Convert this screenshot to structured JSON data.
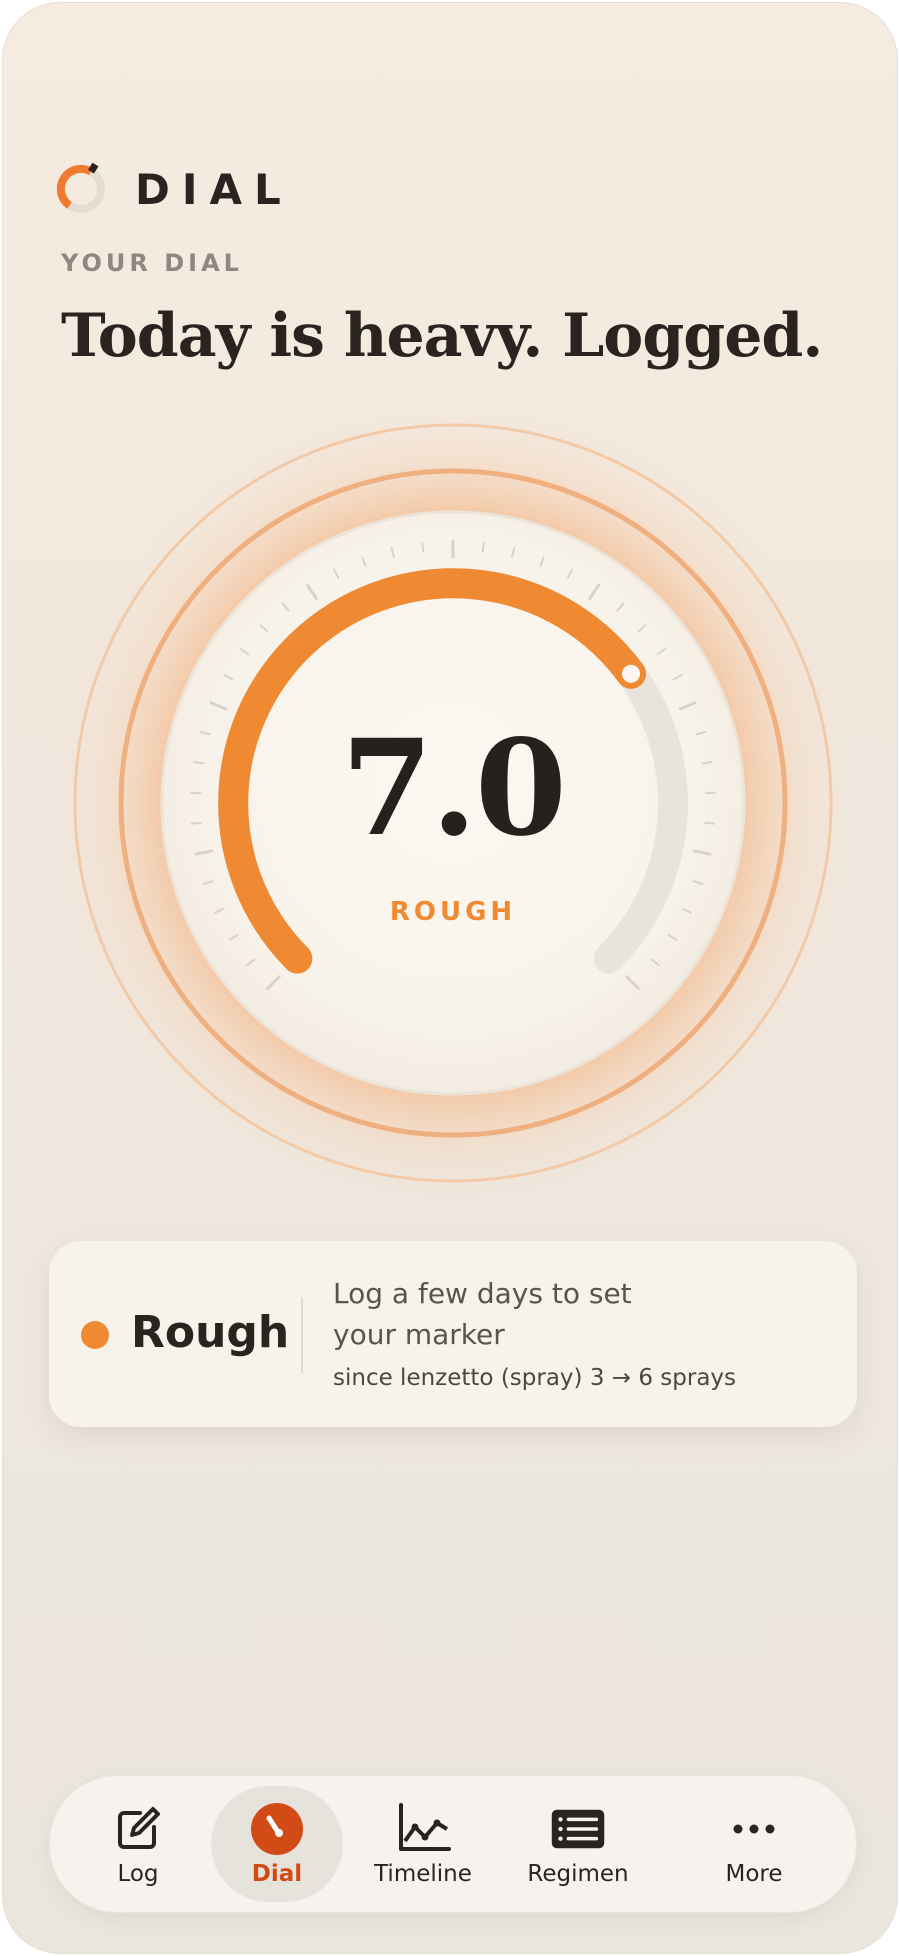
{
  "app": {
    "name": "DIAL",
    "accent_color": "#f08a32"
  },
  "header": {
    "eyebrow": "YOUR DIAL",
    "headline": "Today is heavy. Logged."
  },
  "dial": {
    "value": "7.0",
    "state_label": "ROUGH",
    "fill_fraction": 0.7,
    "fill_color": "#f08a32",
    "track_color": "#e8e4dd"
  },
  "status_card": {
    "state": "Rough",
    "dot_color": "#f08a32",
    "message": "Log a few days to set your marker",
    "detail": "since lenzetto (spray) 3 → 6 sprays"
  },
  "nav": {
    "items": [
      {
        "label": "Log",
        "icon": "edit-icon",
        "active": false
      },
      {
        "label": "Dial",
        "icon": "dial-icon",
        "active": true
      },
      {
        "label": "Timeline",
        "icon": "line-chart-icon",
        "active": false
      },
      {
        "label": "Regimen",
        "icon": "list-icon",
        "active": false
      },
      {
        "label": "More",
        "icon": "more-dots-icon",
        "active": false
      }
    ],
    "active_color": "#d24a15"
  }
}
